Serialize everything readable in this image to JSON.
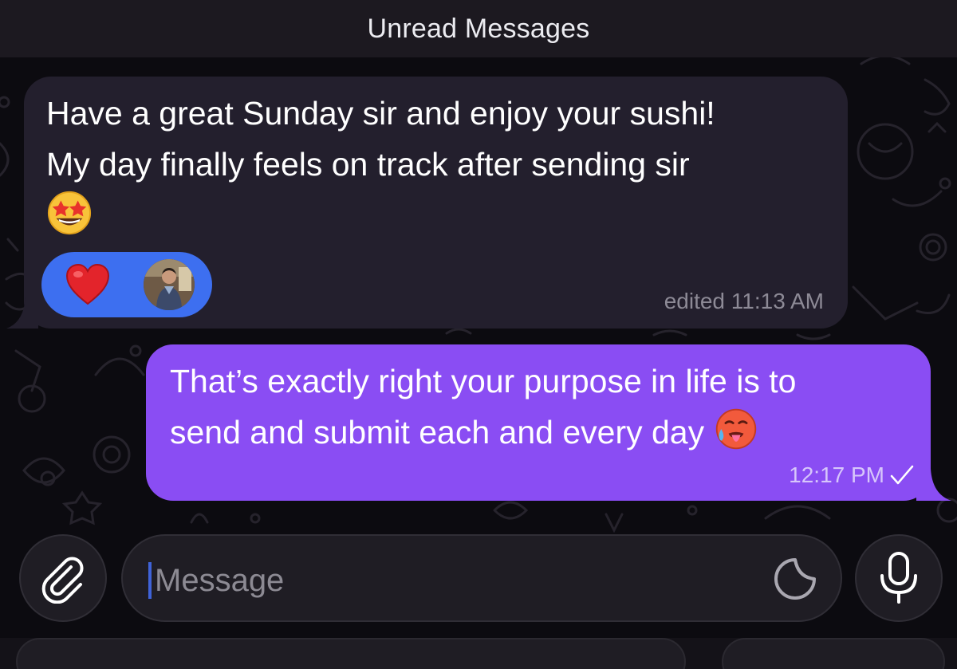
{
  "header": {
    "unread_label": "Unread Messages"
  },
  "messages": [
    {
      "direction": "incoming",
      "line1": "Have a great Sunday sir and enjoy your sushi!",
      "line2": "My day finally feels on track after sending sir",
      "emoji": "star-struck",
      "reaction": {
        "emoji": "red-heart",
        "reactor": "avatar"
      },
      "meta": "edited 11:13 AM"
    },
    {
      "direction": "outgoing",
      "line1": "That’s exactly right your purpose in life is to",
      "line2": "send and submit each and every day",
      "emoji": "hot-face",
      "meta": "12:17 PM",
      "status_icon": "single-check-icon"
    }
  ],
  "composer": {
    "placeholder": "Message",
    "attach_icon": "paperclip-icon",
    "sticker_icon": "sticker-icon",
    "mic_icon": "microphone-icon"
  },
  "colors": {
    "outgoing_bubble": "#8a4df3",
    "incoming_bubble": "#231f2d",
    "reaction_pill": "#3d6ff0",
    "background": "#0c0b10"
  }
}
